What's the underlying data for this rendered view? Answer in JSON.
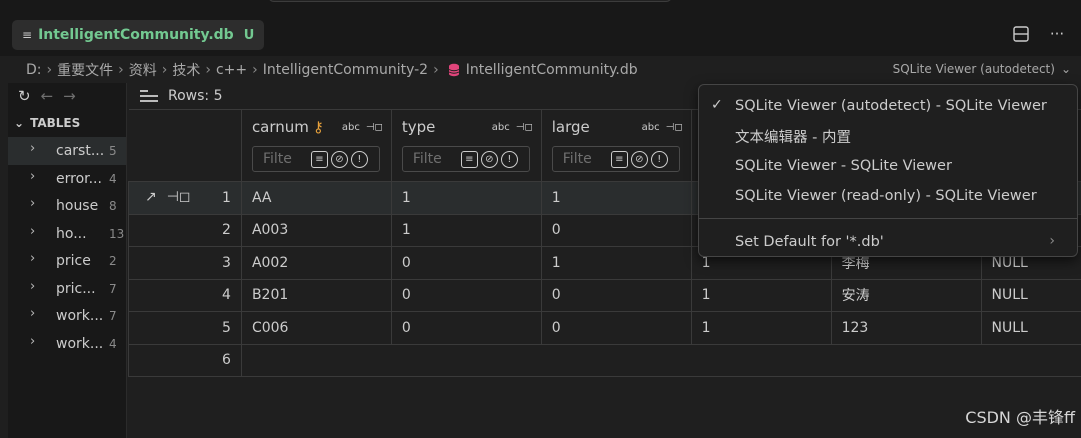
{
  "tab": {
    "label": "IntelligentCommunity.db",
    "badge": "U",
    "icon": "file-lines-icon"
  },
  "tab_actions": [
    "split-editor-icon",
    "more-actions-icon"
  ],
  "breadcrumb": [
    "D:",
    "重要文件",
    "资料",
    "技术",
    "c++",
    "IntelligentCommunity-2",
    "IntelligentCommunity.db"
  ],
  "editor_select": {
    "label": "SQLite Viewer (autodetect)"
  },
  "sidebar": {
    "section_title": "TABLES",
    "tables": [
      {
        "name": "carst...",
        "count": "5"
      },
      {
        "name": "error...",
        "count": "4"
      },
      {
        "name": "house",
        "count": "8"
      },
      {
        "name": "ho...",
        "count": "13"
      },
      {
        "name": "price",
        "count": "2"
      },
      {
        "name": "pric...",
        "count": "7"
      },
      {
        "name": "work...",
        "count": "7"
      },
      {
        "name": "work...",
        "count": "4"
      }
    ]
  },
  "grid": {
    "rows_label": "Rows: 5",
    "filter_placeholder": "Filte",
    "type_tag": "abc",
    "columns": [
      {
        "name": "carnum"
      },
      {
        "name": "type"
      },
      {
        "name": "large"
      }
    ],
    "rows": [
      {
        "n": "1",
        "cells": [
          "AA",
          "1",
          "1",
          "",
          "",
          ""
        ]
      },
      {
        "n": "2",
        "cells": [
          "A003",
          "1",
          "0",
          "",
          "",
          ""
        ]
      },
      {
        "n": "3",
        "cells": [
          "A002",
          "0",
          "1",
          "1",
          "李梅",
          "NULL"
        ]
      },
      {
        "n": "4",
        "cells": [
          "B201",
          "0",
          "0",
          "1",
          "安涛",
          "NULL"
        ]
      },
      {
        "n": "5",
        "cells": [
          "C006",
          "0",
          "0",
          "1",
          "123",
          "NULL"
        ]
      }
    ],
    "new_row_number": "6"
  },
  "dropdown": {
    "items": [
      {
        "label": "SQLite Viewer (autodetect) - SQLite Viewer",
        "checked": true
      },
      {
        "label": "文本编辑器 - 内置"
      },
      {
        "label": "SQLite Viewer - SQLite Viewer"
      },
      {
        "label": "SQLite Viewer (read-only) - SQLite Viewer"
      }
    ],
    "default_label": "Set Default for '*.db'"
  },
  "watermark": "CSDN @丰锋ff"
}
